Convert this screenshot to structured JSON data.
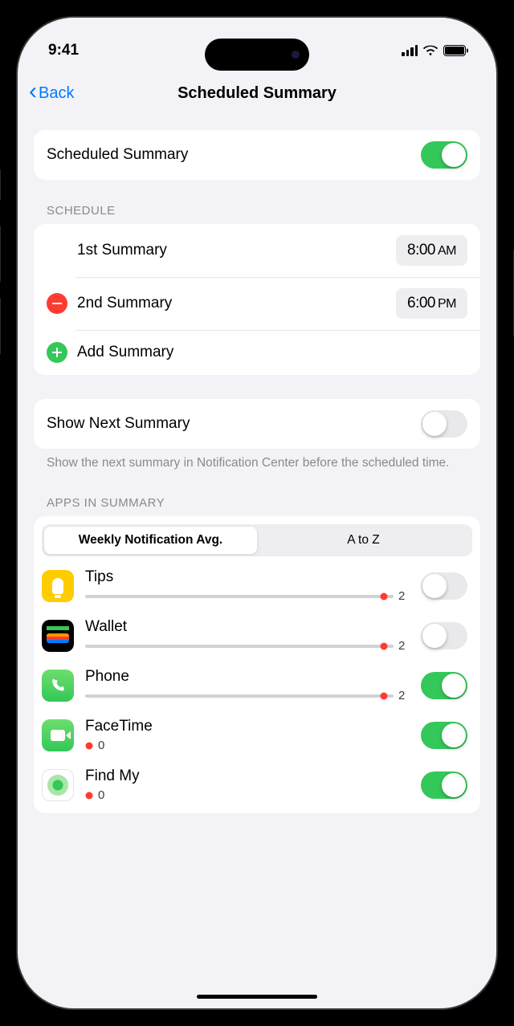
{
  "status": {
    "time": "9:41"
  },
  "nav": {
    "back": "Back",
    "title": "Scheduled Summary"
  },
  "master_toggle": {
    "label": "Scheduled Summary",
    "enabled": true
  },
  "schedule": {
    "header": "SCHEDULE",
    "items": [
      {
        "label": "1st Summary",
        "time": "8:00",
        "ampm": "AM",
        "deletable": false
      },
      {
        "label": "2nd Summary",
        "time": "6:00",
        "ampm": "PM",
        "deletable": true
      }
    ],
    "add_label": "Add Summary"
  },
  "show_next": {
    "label": "Show Next Summary",
    "enabled": false,
    "footer": "Show the next summary in Notification Center before the scheduled time."
  },
  "apps": {
    "header": "APPS IN SUMMARY",
    "sort_options": [
      "Weekly Notification Avg.",
      "A to Z"
    ],
    "sort_selected": 0,
    "list": [
      {
        "name": "Tips",
        "count": "2",
        "enabled": false,
        "dot_pct": 97
      },
      {
        "name": "Wallet",
        "count": "2",
        "enabled": false,
        "dot_pct": 97
      },
      {
        "name": "Phone",
        "count": "2",
        "enabled": true,
        "dot_pct": 97
      },
      {
        "name": "FaceTime",
        "count": "0",
        "enabled": true,
        "dot_pct": 3
      },
      {
        "name": "Find My",
        "count": "0",
        "enabled": true,
        "dot_pct": 3
      }
    ]
  }
}
